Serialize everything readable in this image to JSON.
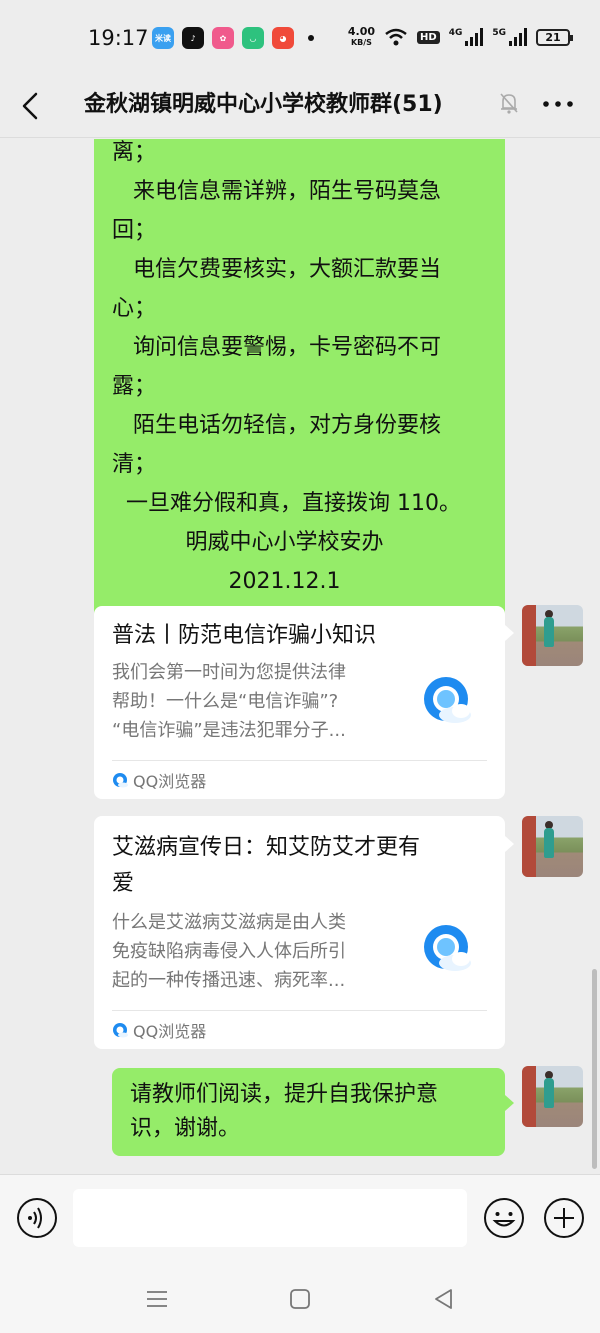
{
  "status_bar": {
    "time": "19:17",
    "apps": [
      {
        "name": "miyou-app-icon",
        "label": "米读",
        "color": "#3aa0f0"
      },
      {
        "name": "douyin-app-icon",
        "label": "♪",
        "color": "#111111"
      },
      {
        "name": "flower-app-icon",
        "label": "✿",
        "color": "#f05a8c"
      },
      {
        "name": "green-app-icon",
        "label": "◡",
        "color": "#2ec27e"
      },
      {
        "name": "red-app-icon",
        "label": "◕",
        "color": "#f04a3a"
      }
    ],
    "net_speed": "4.00",
    "net_unit": "KB/S",
    "hd_label": "HD",
    "net_type_1": "4G",
    "net_type_2": "5G",
    "battery": "21"
  },
  "header": {
    "title": "金秋湖镇明威中心小学校教师群(51)"
  },
  "messages": {
    "notice": {
      "lines": [
        "离；",
        "   来电信息需详辨，陌生号码莫急",
        "回；",
        "   电信欠费要核实，大额汇款要当",
        "心；",
        "   询问信息要警惕，卡号密码不可",
        "露；",
        "   陌生电话勿轻信，对方身份要核",
        "清；",
        "  一旦难分假和真，直接拨询 110。"
      ],
      "signature": "明威中心小学校安办",
      "date": "2021.12.1"
    },
    "card1": {
      "title": "普法丨防范电信诈骗小知识",
      "desc_lines": [
        "我们会第一时间为您提供法律",
        "帮助！一什么是“电信诈骗”?",
        "“电信诈骗”是违法犯罪分子..."
      ],
      "source": "QQ浏览器"
    },
    "card2": {
      "title_lines": [
        "艾滋病宣传日：知艾防艾才更有",
        "爱"
      ],
      "desc_lines": [
        "什么是艾滋病艾滋病是由人类",
        "免疫缺陷病毒侵入人体后所引",
        "起的一种传播迅速、病死率..."
      ],
      "source": "QQ浏览器"
    },
    "last": {
      "lines": [
        "请教师们阅读，提升自我保护意",
        "识，谢谢。"
      ]
    }
  },
  "colors": {
    "bubble_green": "#95ec69",
    "background": "#ededed",
    "qq_blue": "#1e8bf0"
  }
}
